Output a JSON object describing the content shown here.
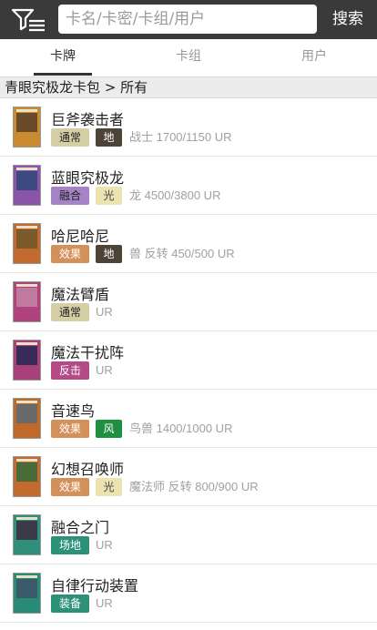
{
  "search": {
    "placeholder": "卡名/卡密/卡组/用户",
    "button": "搜索"
  },
  "tabs": [
    {
      "label": "卡牌"
    },
    {
      "label": "卡组"
    },
    {
      "label": "用户"
    }
  ],
  "breadcrumb": "青眼究极龙卡包 > 所有",
  "cards": [
    {
      "name": "巨斧袭击者",
      "type": "通常",
      "attribute": "地",
      "meta": "战士 1700/1150 UR",
      "frame": "#c98a30",
      "art": "#6a4a2a"
    },
    {
      "name": "蓝眼究极龙",
      "type": "融合",
      "attribute": "光",
      "meta": "龙 4500/3800 UR",
      "frame": "#8a55a8",
      "art": "#3c4a80"
    },
    {
      "name": "哈尼哈尼",
      "type": "效果",
      "attribute": "地",
      "meta": "兽 反转 450/500 UR",
      "frame": "#c36a2e",
      "art": "#7a5a2a"
    },
    {
      "name": "魔法臂盾",
      "type": "通常",
      "attribute": "",
      "meta": "UR",
      "frame": "#b0437d",
      "art": "#c07aa0"
    },
    {
      "name": "魔法干扰阵",
      "type": "反击",
      "attribute": "",
      "meta": "UR",
      "frame": "#a8407a",
      "art": "#3a2a5a"
    },
    {
      "name": "音速鸟",
      "type": "效果",
      "attribute": "风",
      "meta": "鸟兽 1400/1000 UR",
      "frame": "#c06a2a",
      "art": "#6a6a6a"
    },
    {
      "name": "幻想召唤师",
      "type": "效果",
      "attribute": "光",
      "meta": "魔法师 反转 800/900 UR",
      "frame": "#c36a2e",
      "art": "#4a6a3a"
    },
    {
      "name": "融合之门",
      "type": "场地",
      "attribute": "",
      "meta": "UR",
      "frame": "#2f8f7a",
      "art": "#3a3a4a"
    },
    {
      "name": "自律行动装置",
      "type": "装备",
      "attribute": "",
      "meta": "UR",
      "frame": "#2a8a78",
      "art": "#3a5a6a"
    }
  ],
  "tag_colors": {
    "通常": {
      "bg": "#d6cfa6",
      "fg": "#222222"
    },
    "融合": {
      "bg": "#a683c4",
      "fg": "#222222"
    },
    "效果": {
      "bg": "#d3915a",
      "fg": "#ffffff"
    },
    "反击": {
      "bg": "#b44a86",
      "fg": "#ffffff"
    },
    "场地": {
      "bg": "#2d917a",
      "fg": "#ffffff"
    },
    "装备": {
      "bg": "#2d917a",
      "fg": "#ffffff"
    },
    "地": {
      "bg": "#4e4338",
      "fg": "#ffffff"
    },
    "光": {
      "bg": "#ece3b0",
      "fg": "#444444"
    },
    "风": {
      "bg": "#1f8f42",
      "fg": "#ffffff"
    }
  },
  "icons": {
    "filter": "filter-list-icon"
  }
}
